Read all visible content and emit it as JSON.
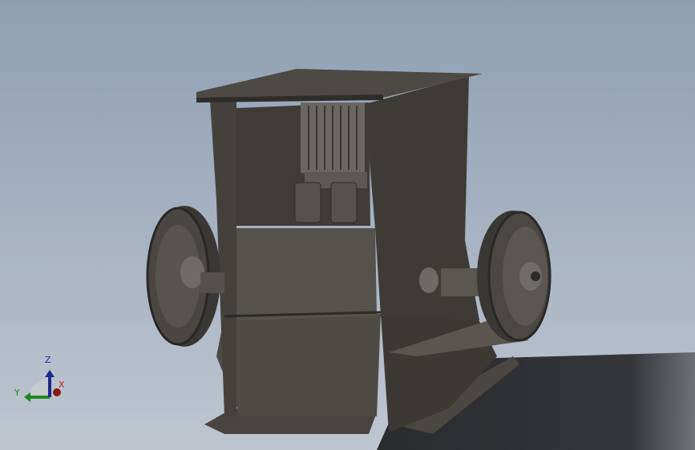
{
  "viewport": {
    "model_name_visible": false,
    "colors": {
      "body": "#4f4b45",
      "body_dark": "#3a3732",
      "shadow": "#2e2f31",
      "background_top": "#8f9fb2",
      "background_bottom": "#bfc6d0"
    }
  },
  "triad": {
    "x_label": "X",
    "y_label": "Y",
    "z_label": "Z",
    "x_color": "#c81e1e",
    "y_color": "#1f8a1f",
    "z_color": "#1c2a8c"
  }
}
